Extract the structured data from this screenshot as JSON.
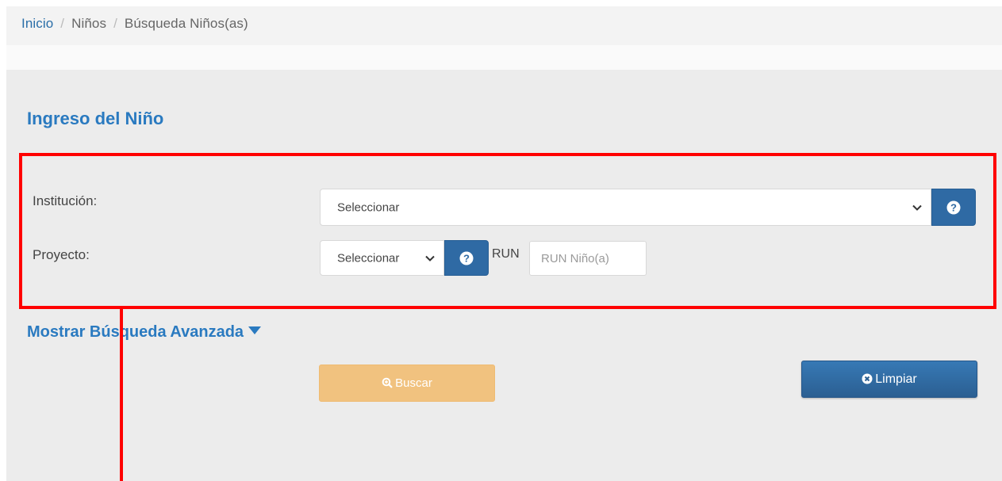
{
  "breadcrumb": {
    "items": [
      "Inicio",
      "Niños",
      "Búsqueda Niños(as)"
    ],
    "separator": "/"
  },
  "form": {
    "title": "Ingreso del Niño",
    "institucion": {
      "label": "Institución:",
      "selected": "Seleccionar"
    },
    "proyecto": {
      "label": "Proyecto:",
      "selected": "Seleccionar"
    },
    "run": {
      "label": "RUN",
      "placeholder": "RUN Niño(a)"
    },
    "help_icon": "?"
  },
  "advanced_search": {
    "label": "Mostrar Búsqueda Avanzada"
  },
  "buttons": {
    "buscar": "Buscar",
    "limpiar": "Limpiar"
  },
  "colors": {
    "accent_blue": "#2a7ac0",
    "button_blue": "#2f6aa4",
    "buscar_orange": "#f1c27f",
    "highlight_red": "#ff0000"
  },
  "icons": {
    "chevron": "chevron-down-icon",
    "help": "help-icon",
    "search": "search-icon",
    "clear": "clear-icon",
    "caret": "caret-down-icon"
  }
}
